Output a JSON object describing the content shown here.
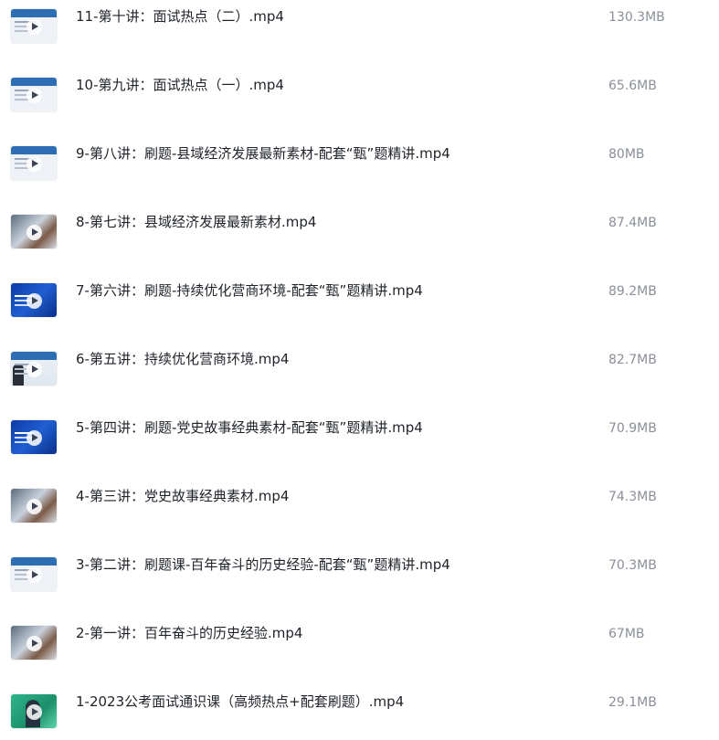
{
  "files": [
    {
      "name": "11-第十讲：面试热点（二）.mp4",
      "size": "130.3MB",
      "thumb": "slide"
    },
    {
      "name": "10-第九讲：面试热点（一）.mp4",
      "size": "65.6MB",
      "thumb": "slide"
    },
    {
      "name": "9-第八讲：刷题-县域经济发展最新素材-配套“甄”题精讲.mp4",
      "size": "80MB",
      "thumb": "slide"
    },
    {
      "name": "8-第七讲：县域经济发展最新素材.mp4",
      "size": "87.4MB",
      "thumb": "photo"
    },
    {
      "name": "7-第六讲：刷题-持续优化营商环境-配套“甄”题精讲.mp4",
      "size": "89.2MB",
      "thumb": "blue"
    },
    {
      "name": "6-第五讲：持续优化营商环境.mp4",
      "size": "82.7MB",
      "thumb": "person"
    },
    {
      "name": "5-第四讲：刷题-党史故事经典素材-配套“甄”题精讲.mp4",
      "size": "70.9MB",
      "thumb": "blue"
    },
    {
      "name": "4-第三讲：党史故事经典素材.mp4",
      "size": "74.3MB",
      "thumb": "photo"
    },
    {
      "name": "3-第二讲：刷题课-百年奋斗的历史经验-配套“甄”题精讲.mp4",
      "size": "70.3MB",
      "thumb": "slide"
    },
    {
      "name": "2-第一讲：百年奋斗的历史经验.mp4",
      "size": "67MB",
      "thumb": "photo"
    },
    {
      "name": "1-2023公考面试通识课（高频热点+配套刷题）.mp4",
      "size": "29.1MB",
      "thumb": "green"
    }
  ],
  "icons": {
    "thumbnail_play": "play-icon"
  },
  "colors": {
    "name_text": "#1f2329",
    "size_text": "#8a8f99",
    "slide_header": "#2c6db3"
  }
}
